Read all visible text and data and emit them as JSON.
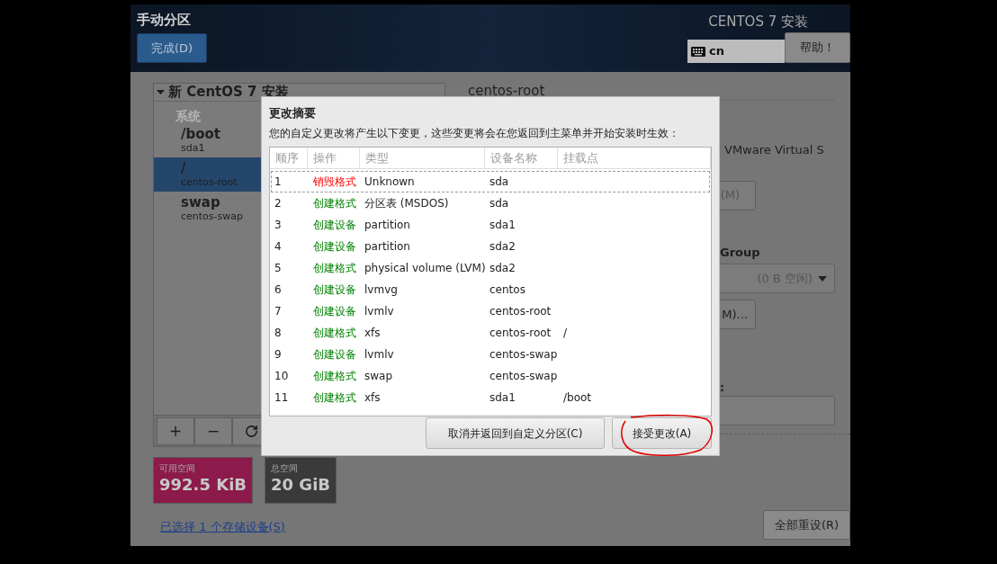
{
  "header": {
    "title": "手动分区",
    "done_button": "完成(D)",
    "product": "CENTOS 7 安装",
    "keyboard_layout": "cn",
    "help_button": "帮助！"
  },
  "tree": {
    "root": "新 CentOS 7 安装",
    "expanded": true,
    "groups": [
      {
        "label": "系统",
        "items": [
          {
            "name": "/boot",
            "device": "sda1",
            "selected": false
          },
          {
            "name": "/",
            "device": "centos-root",
            "selected": true
          },
          {
            "name": "swap",
            "device": "centos-swap",
            "selected": false
          }
        ]
      }
    ]
  },
  "toolbar": [
    "+",
    "−"
  ],
  "space": [
    {
      "label": "可用空间",
      "value": "992.5 KiB",
      "color": "#8c1a4a"
    },
    {
      "label": "总空间",
      "value": "20 GiB",
      "color": "#3a3a3a"
    }
  ],
  "storage_link": "已选择 1 个存储设备(S)",
  "details": {
    "heading": "centos-root",
    "device": "VMware Virtual S",
    "modify_button": "(M)",
    "group_label": "Group",
    "group_dropdown": "(0 B 空闲)",
    "modify_group_button": "M)...",
    "field_label": ":"
  },
  "reset_button": "全部重设(R)",
  "dialog": {
    "title": "更改摘要",
    "description": "您的自定义更改将产生以下变更，这些变更将会在您返回到主菜单并开始安装时生效：",
    "columns": [
      "顺序",
      "操作",
      "类型",
      "设备名称",
      "挂载点"
    ],
    "rows": [
      {
        "order": "1",
        "action": "销毁格式",
        "kind": "destroy",
        "type": "Unknown",
        "device": "sda",
        "mount": "",
        "selected": true
      },
      {
        "order": "2",
        "action": "创建格式",
        "kind": "create",
        "type": "分区表 (MSDOS)",
        "device": "sda",
        "mount": "",
        "selected": false
      },
      {
        "order": "3",
        "action": "创建设备",
        "kind": "create",
        "type": "partition",
        "device": "sda1",
        "mount": "",
        "selected": false
      },
      {
        "order": "4",
        "action": "创建设备",
        "kind": "create",
        "type": "partition",
        "device": "sda2",
        "mount": "",
        "selected": false
      },
      {
        "order": "5",
        "action": "创建格式",
        "kind": "create",
        "type": "physical volume (LVM)",
        "device": "sda2",
        "mount": "",
        "selected": false
      },
      {
        "order": "6",
        "action": "创建设备",
        "kind": "create",
        "type": "lvmvg",
        "device": "centos",
        "mount": "",
        "selected": false
      },
      {
        "order": "7",
        "action": "创建设备",
        "kind": "create",
        "type": "lvmlv",
        "device": "centos-root",
        "mount": "",
        "selected": false
      },
      {
        "order": "8",
        "action": "创建格式",
        "kind": "create",
        "type": "xfs",
        "device": "centos-root",
        "mount": "/",
        "selected": false
      },
      {
        "order": "9",
        "action": "创建设备",
        "kind": "create",
        "type": "lvmlv",
        "device": "centos-swap",
        "mount": "",
        "selected": false
      },
      {
        "order": "10",
        "action": "创建格式",
        "kind": "create",
        "type": "swap",
        "device": "centos-swap",
        "mount": "",
        "selected": false
      },
      {
        "order": "11",
        "action": "创建格式",
        "kind": "create",
        "type": "xfs",
        "device": "sda1",
        "mount": "/boot",
        "selected": false
      }
    ],
    "buttons": [
      "取消并返回到自定义分区(C)",
      "接受更改(A)"
    ]
  }
}
